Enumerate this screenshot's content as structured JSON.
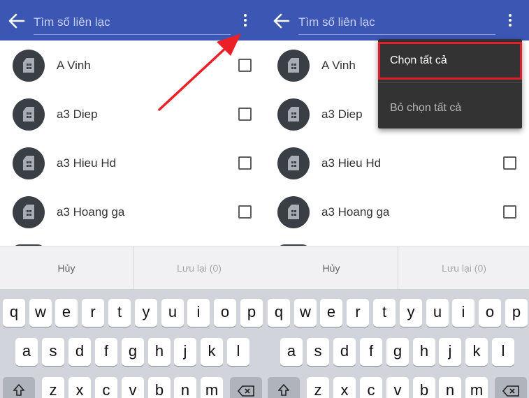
{
  "search": {
    "placeholder": "Tìm số liên lạc"
  },
  "contacts": [
    {
      "name": "A Vinh"
    },
    {
      "name": "a3 Diep"
    },
    {
      "name": "a3 Hieu Hd"
    },
    {
      "name": "a3 Hoang ga"
    }
  ],
  "actions": {
    "cancel_label": "Hủy",
    "save_label": "Lưu lại (0)"
  },
  "menu": {
    "select_all": "Chọn tất cả",
    "deselect_all": "Bỏ chọn tất cả"
  },
  "keyboard": {
    "row1": [
      "q",
      "w",
      "e",
      "r",
      "t",
      "y",
      "u",
      "i",
      "o",
      "p"
    ],
    "row2": [
      "a",
      "s",
      "d",
      "f",
      "g",
      "h",
      "j",
      "k",
      "l"
    ],
    "row3": [
      "z",
      "x",
      "c",
      "v",
      "b",
      "n",
      "m"
    ]
  },
  "icons": {
    "back": "arrow-left-icon",
    "more": "more-vert-icon",
    "avatar": "sim-card-icon",
    "shift": "shift-icon",
    "backspace": "backspace-icon"
  },
  "colors": {
    "appbar": "#3c56b4",
    "menu_bg": "#333333",
    "highlight": "#e11f2c",
    "avatar_bg": "#3a3e45",
    "keyboard_bg": "#d1d4da"
  }
}
